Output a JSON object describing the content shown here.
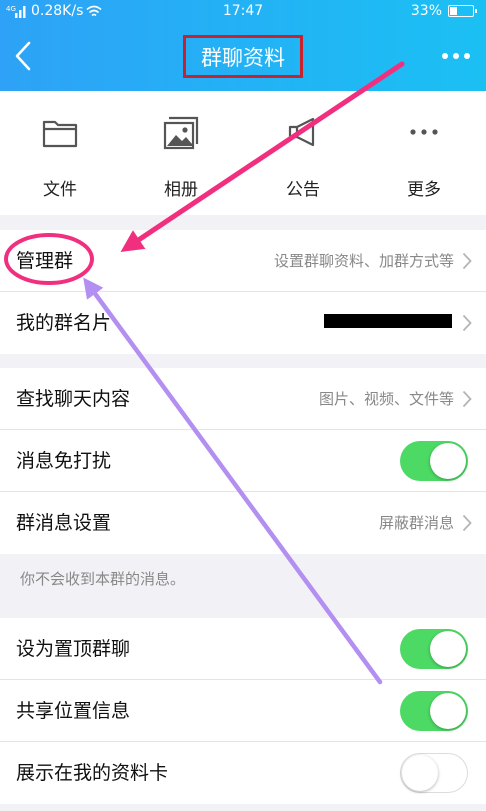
{
  "status_bar": {
    "network": "0.28K/s",
    "time": "17:47",
    "battery": "33%",
    "battery_level": 0.33
  },
  "nav": {
    "title": "群聊资料"
  },
  "quick_actions": [
    {
      "label": "文件",
      "icon": "folder-icon"
    },
    {
      "label": "相册",
      "icon": "photo-album-icon"
    },
    {
      "label": "公告",
      "icon": "announcement-icon"
    },
    {
      "label": "更多",
      "icon": "more-dots-icon"
    }
  ],
  "group1": [
    {
      "label": "管理群",
      "value": "设置群聊资料、加群方式等"
    },
    {
      "label": "我的群名片",
      "value": ""
    }
  ],
  "group2": [
    {
      "label": "查找聊天内容",
      "value": "图片、视频、文件等"
    },
    {
      "label": "消息免打扰",
      "toggle": true
    },
    {
      "label": "群消息设置",
      "value": "屏蔽群消息"
    }
  ],
  "note": "你不会收到本群的消息。",
  "group3": [
    {
      "label": "设为置顶群聊",
      "toggle": true
    },
    {
      "label": "共享位置信息",
      "toggle": true
    },
    {
      "label": "展示在我的资料卡",
      "toggle": false
    }
  ],
  "colors": {
    "header_start": "#2ea2f6",
    "header_end": "#1bc0f3",
    "toggle_on": "#4cd964",
    "annotation_pink": "#f0307f",
    "annotation_purple": "#b28ff0",
    "title_box": "#c8232c"
  }
}
